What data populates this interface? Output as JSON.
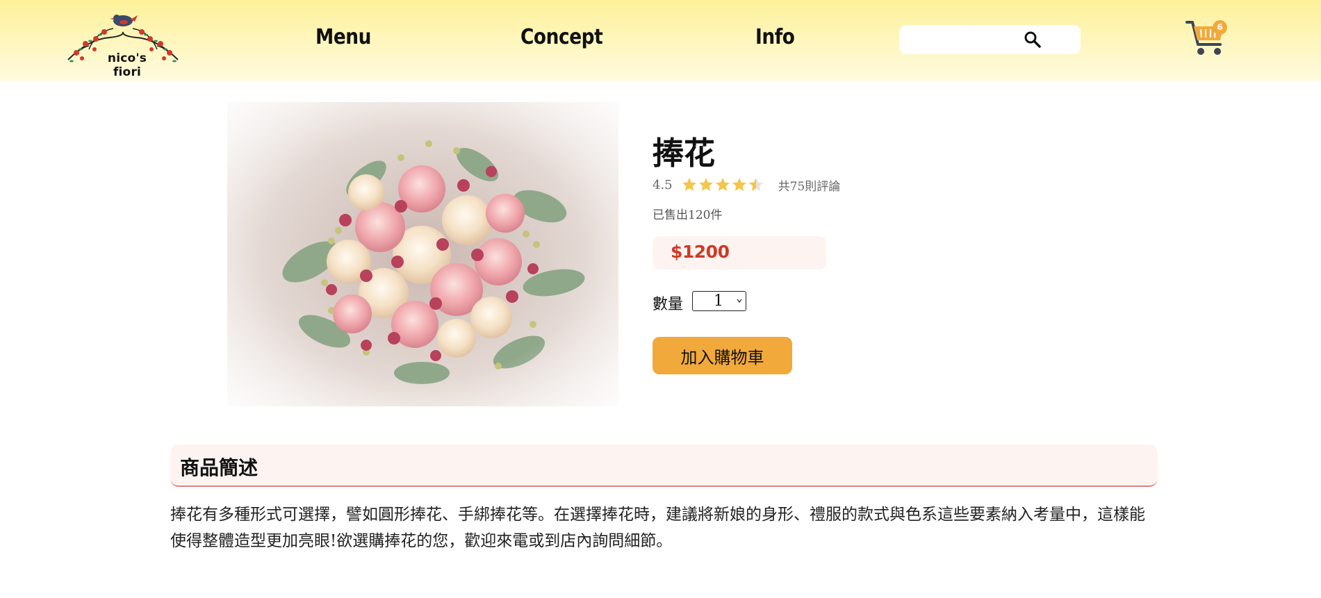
{
  "header": {
    "logo_text": "nico's fiori",
    "nav": [
      {
        "label": "Menu"
      },
      {
        "label": "Concept"
      },
      {
        "label": "Info"
      }
    ],
    "search": {
      "placeholder": "",
      "value": ""
    },
    "cart_count": "6"
  },
  "product": {
    "title": "捧花",
    "rating": "4.5",
    "rating_value": 4.5,
    "rating_max": 5,
    "review_count": "共75則評論",
    "sold": "已售出120件",
    "price": "$1200",
    "quantity_label": "數量",
    "quantity": "1",
    "add_to_cart": "加入購物車"
  },
  "description": {
    "title": "商品簡述",
    "text": "捧花有多種形式可選擇，譬如圓形捧花、手綁捧花等。在選擇捧花時，建議將新娘的身形、禮服的款式與色系這些要素納入考量中，這樣能使得整體造型更加亮眼!欲選購捧花的您，歡迎來電或到店內詢問細節。"
  },
  "colors": {
    "accent": "#f2a93b",
    "price": "#d03a25",
    "star": "#f4c54a",
    "header_top": "#fdf19a",
    "desc_bg": "#fdf4f1",
    "desc_underline": "#e08080"
  },
  "icons": {
    "search": "search-icon",
    "cart": "cart-icon",
    "star": "star-icon",
    "chevron": "chevron-down-icon"
  }
}
